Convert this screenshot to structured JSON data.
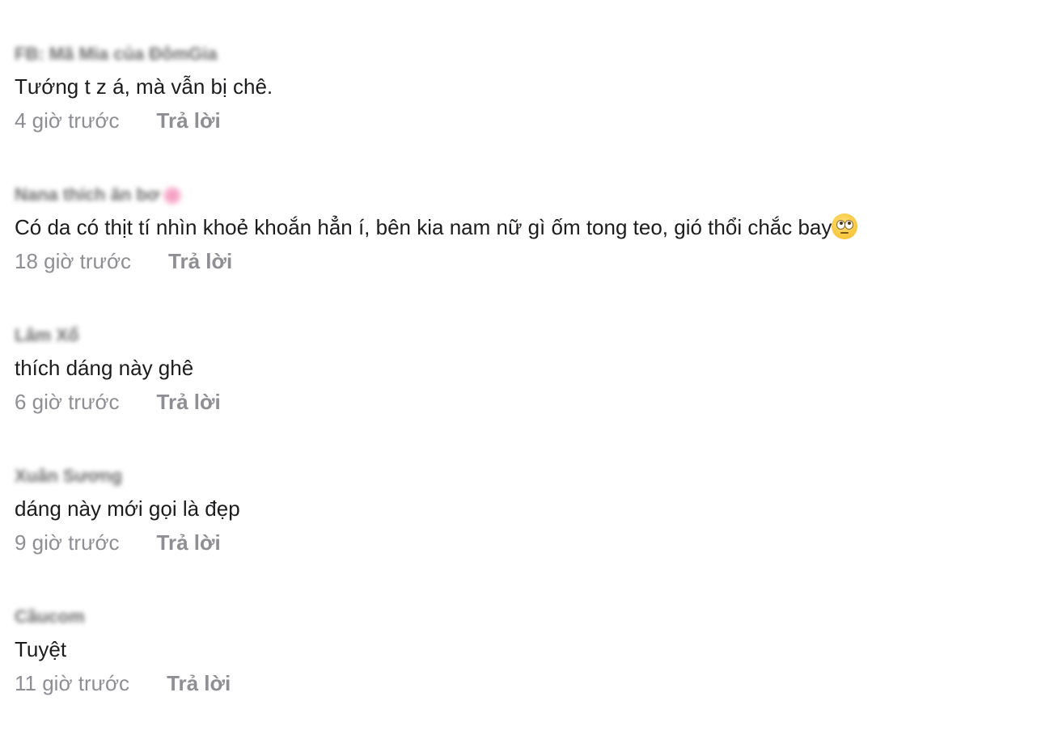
{
  "comments": [
    {
      "author": "FB: Mã Mia của ĐômGia",
      "text": "Tướng t z á, mà vẫn bị chê.",
      "time": "4 giờ trước",
      "reply": "Trả lời"
    },
    {
      "author": "Nana thích ăn bơ",
      "author_icon": "flower-icon",
      "text": "Có da có thịt tí nhìn khoẻ khoắn hẳn í, bên kia nam nữ gì ốm tong teo, gió thổi chắc bay",
      "text_icon": "eye-roll-emoji-icon",
      "time": "18 giờ trước",
      "reply": "Trả lời"
    },
    {
      "author": "Lâm Xổ",
      "text": "thích dáng này ghê",
      "time": "6 giờ trước",
      "reply": "Trả lời"
    },
    {
      "author": "Xuân Sương",
      "text": "dáng này mới gọi là đẹp",
      "time": "9 giờ trước",
      "reply": "Trả lời"
    },
    {
      "author": "Cầucom",
      "text": "Tuyệt",
      "time": "11 giờ trước",
      "reply": "Trả lời"
    }
  ]
}
